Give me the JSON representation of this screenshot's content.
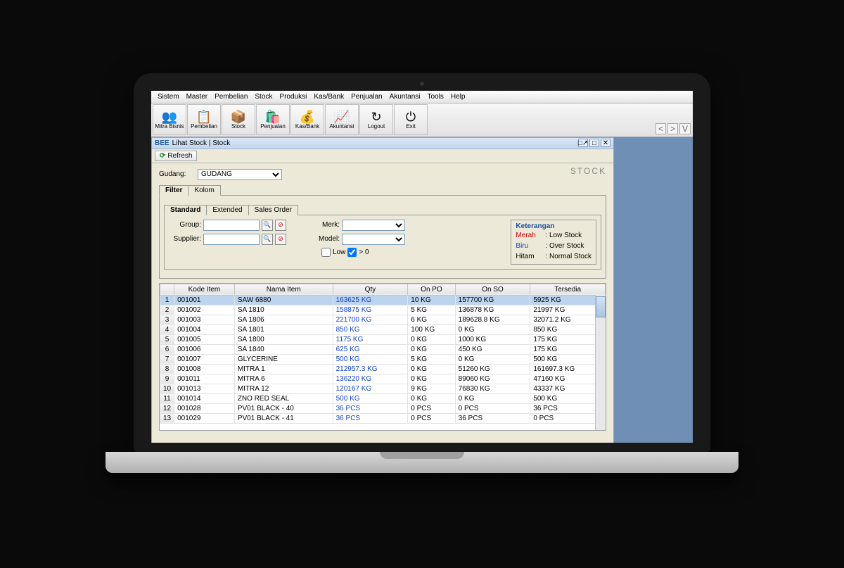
{
  "menu": [
    "Sistem",
    "Master",
    "Pembelian",
    "Stock",
    "Produksi",
    "Kas/Bank",
    "Penjualan",
    "Akuntansi",
    "Tools",
    "Help"
  ],
  "toolbar": [
    {
      "icon": "👥",
      "label": "Mitra Bisnis"
    },
    {
      "icon": "📋",
      "label": "Pembelian"
    },
    {
      "icon": "📦",
      "label": "Stock"
    },
    {
      "icon": "🛍️",
      "label": "Penjualan"
    },
    {
      "icon": "💰",
      "label": "Kas/Bank"
    },
    {
      "icon": "📈",
      "label": "Akuntansi"
    },
    {
      "icon": "↻",
      "label": "Logout"
    },
    {
      "icon": "⏻",
      "label": "Exit"
    }
  ],
  "toolbar_nav": {
    "prev": "<",
    "sep": ">",
    "v": "V"
  },
  "window": {
    "app": "BEE",
    "title": "Lihat Stock | Stock"
  },
  "refresh": "Refresh",
  "page_label": "STOCK",
  "gudang": {
    "label": "Gudang:",
    "value": "GUDANG"
  },
  "tabs_outer": [
    "Filter",
    "Kolom"
  ],
  "tabs_inner": [
    "Standard",
    "Extended",
    "Sales Order"
  ],
  "filters": {
    "group": "Group:",
    "supplier": "Supplier:",
    "merk": "Merk:",
    "model": "Model:",
    "low": "Low",
    "gt0": "> 0"
  },
  "legend": {
    "title": "Keterangan",
    "rows": [
      {
        "k": "Merah",
        "v": ": Low Stock",
        "cls": "c-merah"
      },
      {
        "k": "Biru",
        "v": ": Over Stock",
        "cls": "c-biru"
      },
      {
        "k": "Hitam",
        "v": ": Normal Stock",
        "cls": ""
      }
    ]
  },
  "columns": [
    "",
    "Kode Item",
    "Nama Item",
    "Qty",
    "On PO",
    "On SO",
    "Tersedia"
  ],
  "rows": [
    {
      "n": "1",
      "kode": "001001",
      "nama": "SAW 6880",
      "qty": "163625 KG",
      "po": "10 KG",
      "so": "157700 KG",
      "ter": "5925 KG",
      "sel": true
    },
    {
      "n": "2",
      "kode": "001002",
      "nama": "SA 1810",
      "qty": "158875 KG",
      "po": "5 KG",
      "so": "136878 KG",
      "ter": "21997 KG"
    },
    {
      "n": "3",
      "kode": "001003",
      "nama": "SA 1806",
      "qty": "221700 KG",
      "po": "6 KG",
      "so": "189628.8 KG",
      "ter": "32071.2 KG"
    },
    {
      "n": "4",
      "kode": "001004",
      "nama": "SA 1801",
      "qty": "850 KG",
      "po": "100 KG",
      "so": "0 KG",
      "ter": "850 KG"
    },
    {
      "n": "5",
      "kode": "001005",
      "nama": "SA 1800",
      "qty": "1175 KG",
      "po": "0 KG",
      "so": "1000 KG",
      "ter": "175 KG"
    },
    {
      "n": "6",
      "kode": "001006",
      "nama": "SA 1840",
      "qty": "625 KG",
      "po": "0 KG",
      "so": "450 KG",
      "ter": "175 KG"
    },
    {
      "n": "7",
      "kode": "001007",
      "nama": "GLYCERINE",
      "qty": "500 KG",
      "po": "5 KG",
      "so": "0 KG",
      "ter": "500 KG"
    },
    {
      "n": "8",
      "kode": "001008",
      "nama": "MITRA 1",
      "qty": "212957.3 KG",
      "po": "0 KG",
      "so": "51260 KG",
      "ter": "161697.3 KG"
    },
    {
      "n": "9",
      "kode": "001011",
      "nama": "MITRA 6",
      "qty": "136220 KG",
      "po": "0 KG",
      "so": "89060 KG",
      "ter": "47160 KG"
    },
    {
      "n": "10",
      "kode": "001013",
      "nama": "MITRA 12",
      "qty": "120167 KG",
      "po": "9 KG",
      "so": "76830 KG",
      "ter": "43337 KG"
    },
    {
      "n": "11",
      "kode": "001014",
      "nama": "ZNO RED SEAL",
      "qty": "500 KG",
      "po": "0 KG",
      "so": "0 KG",
      "ter": "500 KG"
    },
    {
      "n": "12",
      "kode": "001028",
      "nama": "PV01 BLACK - 40",
      "qty": "36 PCS",
      "po": "0 PCS",
      "so": "0 PCS",
      "ter": "36 PCS"
    },
    {
      "n": "13",
      "kode": "001029",
      "nama": "PV01 BLACK - 41",
      "qty": "36 PCS",
      "po": "0 PCS",
      "so": "36 PCS",
      "ter": "0 PCS"
    }
  ]
}
